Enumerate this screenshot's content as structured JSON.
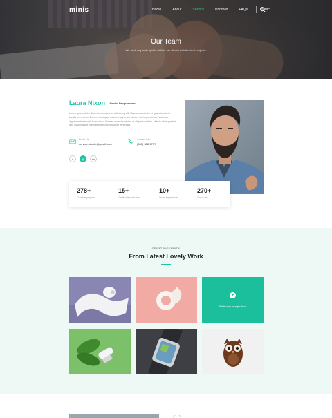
{
  "nav": {
    "logo": "minis",
    "items": [
      {
        "label": "Home",
        "active": false
      },
      {
        "label": "About",
        "active": false
      },
      {
        "label": "Service",
        "active": true
      },
      {
        "label": "Portfolio",
        "active": false
      },
      {
        "label": "FAQs",
        "active": false
      },
      {
        "label": "Contact",
        "active": false
      }
    ],
    "search_icon": "search-icon"
  },
  "hero": {
    "title": "Our Team",
    "subtitle": "We work day and night to deliver our clients with the best projects."
  },
  "profile": {
    "name": "Laura Nixon",
    "role": "- Senior Programmer",
    "bio": "Lorem ipsum dolor sit amet, consectetur adipiscing elit. Maecenas et nibh et quam hendrerit iaculis vel a tortor. Donec consequat mauris magna, vel laoreet nisi imperdiet eu. Vivamus dignissim tortor velit in faucibus. Aenean molestie sapien et aliquam facilisis. Mauris vitae gravida leo. Suspendisse pulvinar tortor non tincidunt venenatis.",
    "email_label": "Email Us",
    "email": "service.simple@gmail.com",
    "phone_label": "Contact Info",
    "phone": "(845) 358-7777",
    "social": [
      {
        "label": "t",
        "icon": "twitter-icon"
      },
      {
        "label": "@",
        "icon": "dribbble-icon"
      },
      {
        "label": "in",
        "icon": "linkedin-icon"
      }
    ]
  },
  "stats": [
    {
      "value": "278+",
      "label": "Creative projects"
    },
    {
      "value": "15+",
      "label": "Certificates of honor"
    },
    {
      "value": "10+",
      "label": "Years experience"
    },
    {
      "value": "270+",
      "label": "Good rate"
    }
  ],
  "work": {
    "eyebrow": "GREAT INGENUITY",
    "title": "From Latest Lovely Work",
    "hover_caption": "Birdthday Imagination"
  },
  "colors": {
    "accent": "#1fc5a0",
    "section_bg": "#eef8f5"
  }
}
